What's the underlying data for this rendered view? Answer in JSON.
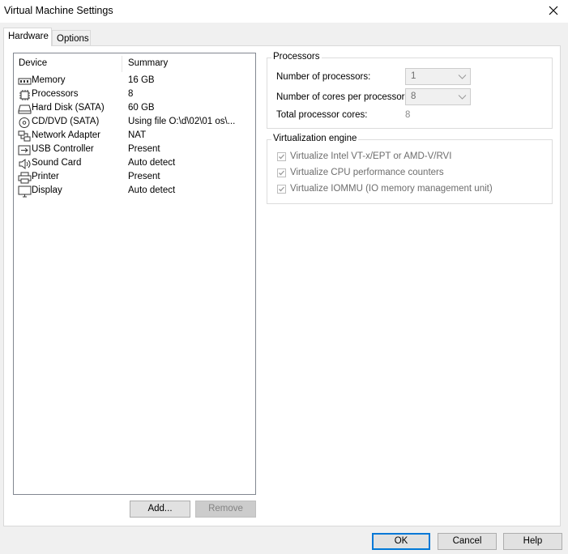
{
  "window": {
    "title": "Virtual Machine Settings"
  },
  "tabs": [
    {
      "label": "Hardware"
    },
    {
      "label": "Options"
    }
  ],
  "device_list": {
    "columns": {
      "device": "Device",
      "summary": "Summary"
    },
    "rows": [
      {
        "name": "Memory",
        "summary": "16 GB",
        "icon": "memory-icon"
      },
      {
        "name": "Processors",
        "summary": "8",
        "icon": "processor-icon"
      },
      {
        "name": "Hard Disk (SATA)",
        "summary": "60 GB",
        "icon": "hard-disk-icon"
      },
      {
        "name": "CD/DVD (SATA)",
        "summary": "Using file O:\\d\\02\\01      os\\...",
        "icon": "cd-dvd-icon"
      },
      {
        "name": "Network Adapter",
        "summary": "NAT",
        "icon": "network-adapter-icon"
      },
      {
        "name": "USB Controller",
        "summary": "Present",
        "icon": "usb-icon"
      },
      {
        "name": "Sound Card",
        "summary": "Auto detect",
        "icon": "speaker-icon"
      },
      {
        "name": "Printer",
        "summary": "Present",
        "icon": "printer-icon"
      },
      {
        "name": "Display",
        "summary": "Auto detect",
        "icon": "display-icon"
      }
    ]
  },
  "buttons": {
    "add": "Add...",
    "remove": "Remove",
    "ok": "OK",
    "cancel": "Cancel",
    "help": "Help"
  },
  "processors": {
    "group_label": "Processors",
    "num_processors_label": "Number of processors:",
    "num_processors_value": "1",
    "cores_label": "Number of cores per processor:",
    "cores_value": "8",
    "total_label": "Total processor cores:",
    "total_value": "8"
  },
  "virtualization": {
    "group_label": "Virtualization engine",
    "options": [
      {
        "label": "Virtualize Intel VT-x/EPT or AMD-V/RVI",
        "checked": true
      },
      {
        "label": "Virtualize CPU performance counters",
        "checked": true
      },
      {
        "label": "Virtualize IOMMU (IO memory management unit)",
        "checked": true
      }
    ]
  },
  "icons": {
    "close": "close-icon",
    "combo_arrow": "chevron-down-icon"
  },
  "colors": {
    "focus_border": "#0078d7",
    "disabled_text": "#6d6d6d"
  }
}
